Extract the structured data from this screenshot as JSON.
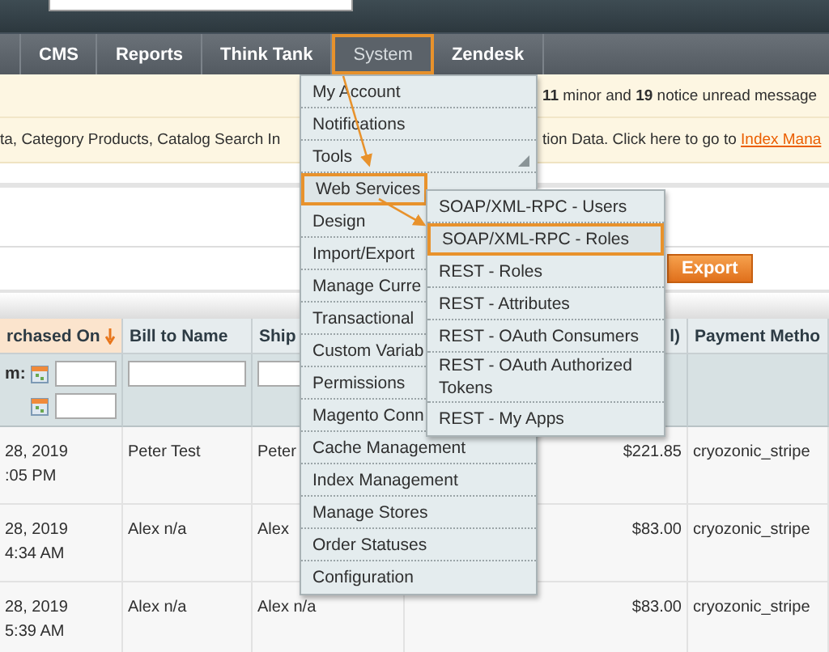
{
  "nav": {
    "tabs": [
      {
        "label": "CMS",
        "selected": false
      },
      {
        "label": "Reports",
        "selected": false
      },
      {
        "label": "Think Tank",
        "selected": false
      },
      {
        "label": "System",
        "selected": true
      },
      {
        "label": "Zendesk",
        "selected": false
      }
    ]
  },
  "notices": [
    {
      "right": "**11** minor and **19** notice unread message"
    },
    {
      "left": "ta, Category Products, Catalog Search In",
      "right": "tion Data. Click here to go to",
      "link": "Index Mana"
    }
  ],
  "toolbar": {
    "export_button": "Export"
  },
  "grid": {
    "columns": [
      {
        "label": "rchased On",
        "sorted": true,
        "numeric": false
      },
      {
        "label": "Bill to Name",
        "sorted": false,
        "numeric": false
      },
      {
        "label": "Ship",
        "sorted": false,
        "numeric": false
      },
      {
        "label": "l)",
        "sorted": false,
        "numeric": true
      },
      {
        "label": "Payment Metho",
        "sorted": false,
        "numeric": false
      }
    ],
    "filter": {
      "date_label": "m:"
    },
    "rows": [
      {
        "cells": [
          "28, 2019\n:05 PM",
          "Peter Test",
          "Peter",
          "$221.85",
          "cryozonic_stripe"
        ]
      },
      {
        "cells": [
          "28, 2019\n4:34 AM",
          "Alex n/a",
          "Alex",
          "$83.00",
          "cryozonic_stripe"
        ]
      },
      {
        "cells": [
          "28, 2019\n5:39 AM",
          "Alex n/a",
          "Alex n/a",
          "$83.00",
          "cryozonic_stripe"
        ]
      }
    ]
  },
  "menu": {
    "items": [
      {
        "label": "My Account",
        "selected": false
      },
      {
        "label": "Notifications",
        "selected": false
      },
      {
        "label": "Tools",
        "selected": false,
        "grip": true
      },
      {
        "label": "Web Services",
        "selected": true
      },
      {
        "label": "Design",
        "selected": false
      },
      {
        "label": "Import/Export",
        "selected": false
      },
      {
        "label": "Manage Curre",
        "selected": false
      },
      {
        "label": "Transactional",
        "selected": false
      },
      {
        "label": "Custom Variab",
        "selected": false
      },
      {
        "label": "Permissions",
        "selected": false
      },
      {
        "label": "Magento Conn",
        "selected": false
      },
      {
        "label": "Cache Management",
        "selected": false
      },
      {
        "label": "Index Management",
        "selected": false
      },
      {
        "label": "Manage Stores",
        "selected": false
      },
      {
        "label": "Order Statuses",
        "selected": false
      },
      {
        "label": "Configuration",
        "selected": false
      }
    ]
  },
  "submenu": {
    "items": [
      {
        "label": "SOAP/XML-RPC - Users",
        "selected": false
      },
      {
        "label": "SOAP/XML-RPC - Roles",
        "selected": true
      },
      {
        "label": "REST - Roles",
        "selected": false
      },
      {
        "label": "REST - Attributes",
        "selected": false
      },
      {
        "label": "REST - OAuth Consumers",
        "selected": false
      },
      {
        "label": "REST - OAuth Authorized Tokens",
        "selected": false
      },
      {
        "label": "REST - My Apps",
        "selected": false
      }
    ]
  }
}
